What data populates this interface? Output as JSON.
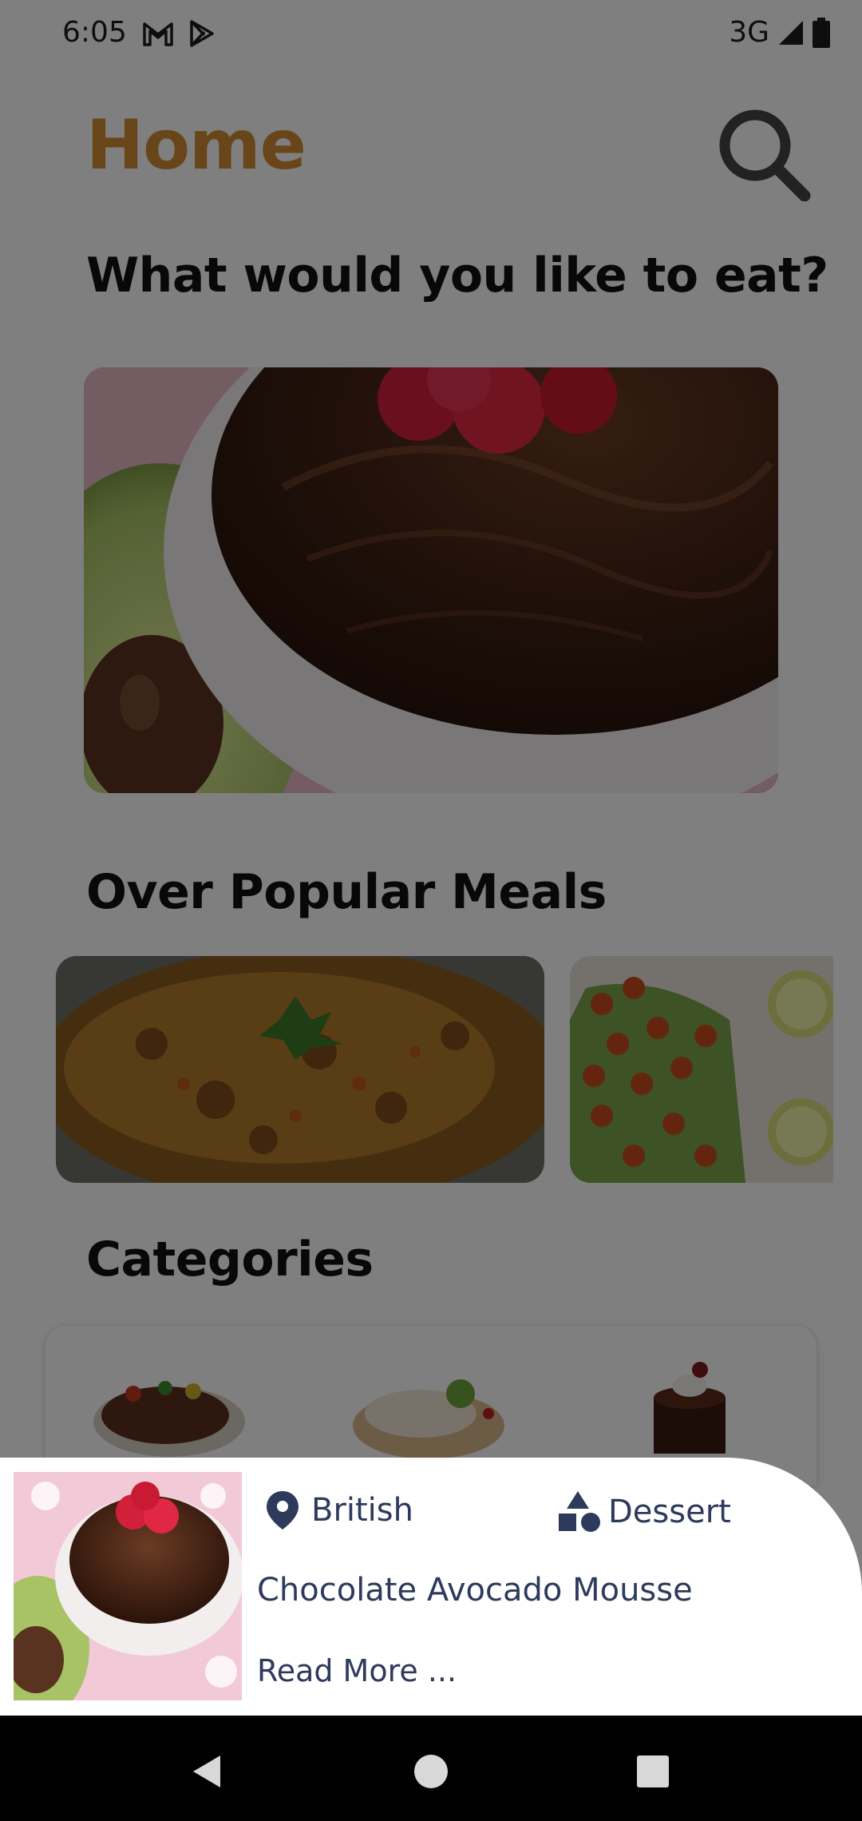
{
  "status_bar": {
    "time": "6:05",
    "left_icons": [
      "gmail-icon",
      "play-store-icon"
    ],
    "network": "3G",
    "right_icons": [
      "signal-icon",
      "battery-icon"
    ]
  },
  "header": {
    "title": "Home",
    "search_icon": "search-icon"
  },
  "prompt": "What would you like to eat?",
  "hero": {
    "image": "chocolate-avocado-mousse-photo"
  },
  "popular": {
    "title": "Over Popular Meals",
    "cards": [
      {
        "image": "minced-meat-dish-photo"
      },
      {
        "image": "chickpea-salad-photo"
      }
    ]
  },
  "categories": {
    "title": "Categories",
    "items": [
      {
        "image": "beef-steak-photo"
      },
      {
        "image": "chicken-photo"
      },
      {
        "image": "dessert-cake-photo"
      }
    ]
  },
  "sheet": {
    "area": "British",
    "category": "Dessert",
    "name": "Chocolate Avocado Mousse",
    "read_more": "Read More ...",
    "area_icon": "location-pin-icon",
    "category_icon": "shapes-icon",
    "thumbnail": "chocolate-avocado-mousse-photo"
  },
  "colors": {
    "accent": "#d38c35",
    "sheet_text": "#2d3a5c",
    "scrim": "rgba(0,0,0,0.5)"
  },
  "nav": [
    "back-icon",
    "home-icon",
    "recents-icon"
  ]
}
